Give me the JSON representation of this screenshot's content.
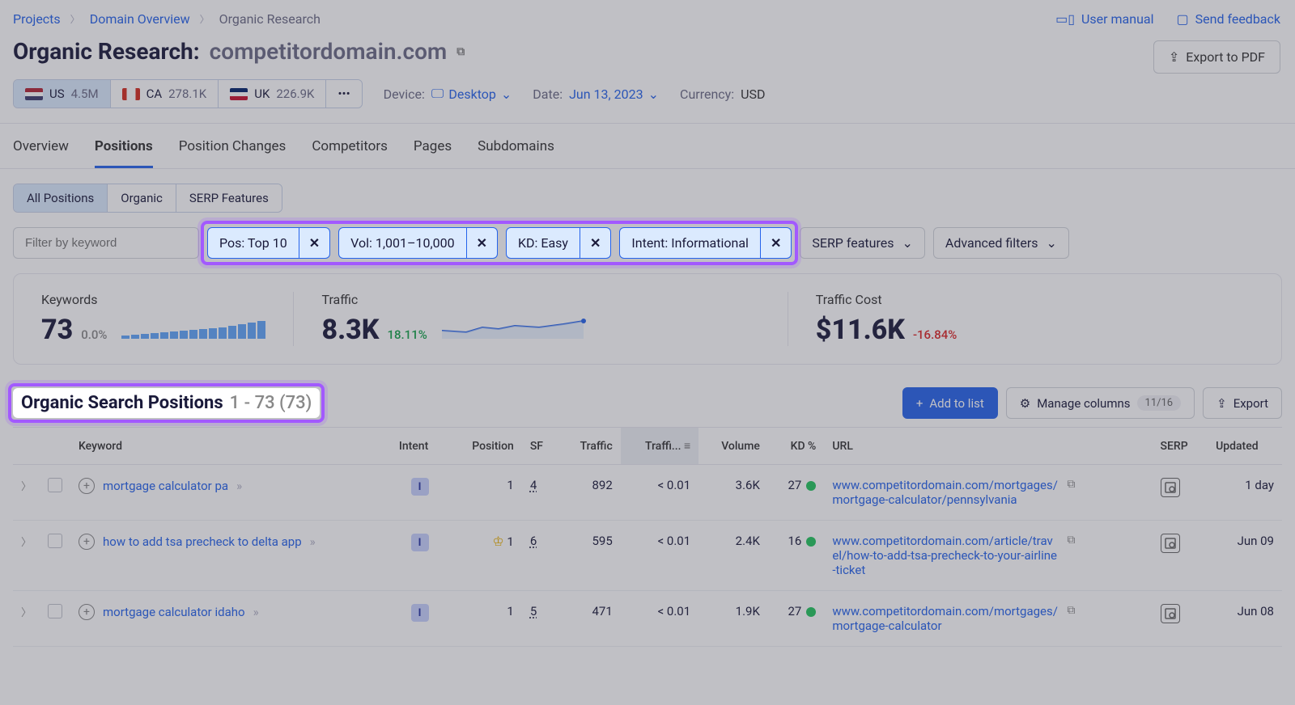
{
  "breadcrumb": {
    "projects": "Projects",
    "domain_overview": "Domain Overview",
    "organic_research": "Organic Research"
  },
  "topright": {
    "manual": "User manual",
    "feedback": "Send feedback"
  },
  "title": {
    "prefix": "Organic Research:",
    "domain": "competitordomain.com"
  },
  "export_pdf": "Export to PDF",
  "countries": [
    {
      "code": "US",
      "value": "4.5M",
      "active": true,
      "flag": "linear-gradient(#b22234 0 33%,#fff 33% 66%,#3c3b6e 66%)"
    },
    {
      "code": "CA",
      "value": "278.1K",
      "active": false,
      "flag": "linear-gradient(90deg,#d52b1e 0 25%,#fff 25% 75%,#d52b1e 75%)"
    },
    {
      "code": "UK",
      "value": "226.9K",
      "active": false,
      "flag": "linear-gradient(#012169 0 33%,#fff 33% 66%,#c8102e 66%)"
    }
  ],
  "more_dots": "•••",
  "meta": {
    "device_label": "Device:",
    "device_val": "Desktop",
    "date_label": "Date:",
    "date_val": "Jun 13, 2023",
    "currency_label": "Currency:",
    "currency_val": "USD"
  },
  "tabs": [
    "Overview",
    "Positions",
    "Position Changes",
    "Competitors",
    "Pages",
    "Subdomains"
  ],
  "tabs_active": 1,
  "subtabs": [
    "All Positions",
    "Organic",
    "SERP Features"
  ],
  "subtabs_active": 0,
  "filter_placeholder": "Filter by keyword",
  "chips": [
    {
      "label": "Pos: Top 10"
    },
    {
      "label": "Vol: 1,001–10,000"
    },
    {
      "label": "KD: Easy"
    },
    {
      "label": "Intent: Informational"
    }
  ],
  "filter_dds": [
    {
      "label": "SERP features"
    },
    {
      "label": "Advanced filters"
    }
  ],
  "metrics": {
    "keywords": {
      "label": "Keywords",
      "value": "73",
      "delta": "0.0%",
      "delta_class": "gray",
      "bars": [
        4,
        5,
        6,
        7,
        8,
        9,
        10,
        11,
        12,
        13,
        14,
        16,
        18,
        20,
        22
      ]
    },
    "traffic": {
      "label": "Traffic",
      "value": "8.3K",
      "delta": "18.11%",
      "delta_class": "green"
    },
    "cost": {
      "label": "Traffic Cost",
      "value": "$11.6K",
      "delta": "-16.84%",
      "delta_class": "red"
    }
  },
  "section": {
    "title": "Organic Search Positions",
    "range": "1 - 73 (73)",
    "add": "Add to list",
    "manage": "Manage columns",
    "manage_count": "11/16",
    "export": "Export"
  },
  "columns": [
    "",
    "",
    "Keyword",
    "Intent",
    "Position",
    "SF",
    "Traffic",
    "Traffi...",
    "Volume",
    "KD %",
    "URL",
    "SERP",
    "Updated"
  ],
  "rows": [
    {
      "keyword": "mortgage calculator pa",
      "intent": "I",
      "position": "1",
      "sf": "4",
      "traffic": "892",
      "traffic_pct": "< 0.01",
      "volume": "3.6K",
      "kd": "27",
      "url": "www.competitordomain.com/mortgages/mortgage-calculator/pennsylvania",
      "updated": "1 day",
      "crown": false
    },
    {
      "keyword": "how to add tsa precheck to delta app",
      "intent": "I",
      "position": "1",
      "sf": "6",
      "traffic": "595",
      "traffic_pct": "< 0.01",
      "volume": "2.4K",
      "kd": "16",
      "url": "www.competitordomain.com/article/travel/how-to-add-tsa-precheck-to-your-airline-ticket",
      "updated": "Jun 09",
      "crown": true
    },
    {
      "keyword": "mortgage calculator idaho",
      "intent": "I",
      "position": "1",
      "sf": "5",
      "traffic": "471",
      "traffic_pct": "< 0.01",
      "volume": "1.9K",
      "kd": "27",
      "url": "www.competitordomain.com/mortgages/mortgage-calculator",
      "updated": "Jun 08",
      "crown": false
    }
  ]
}
